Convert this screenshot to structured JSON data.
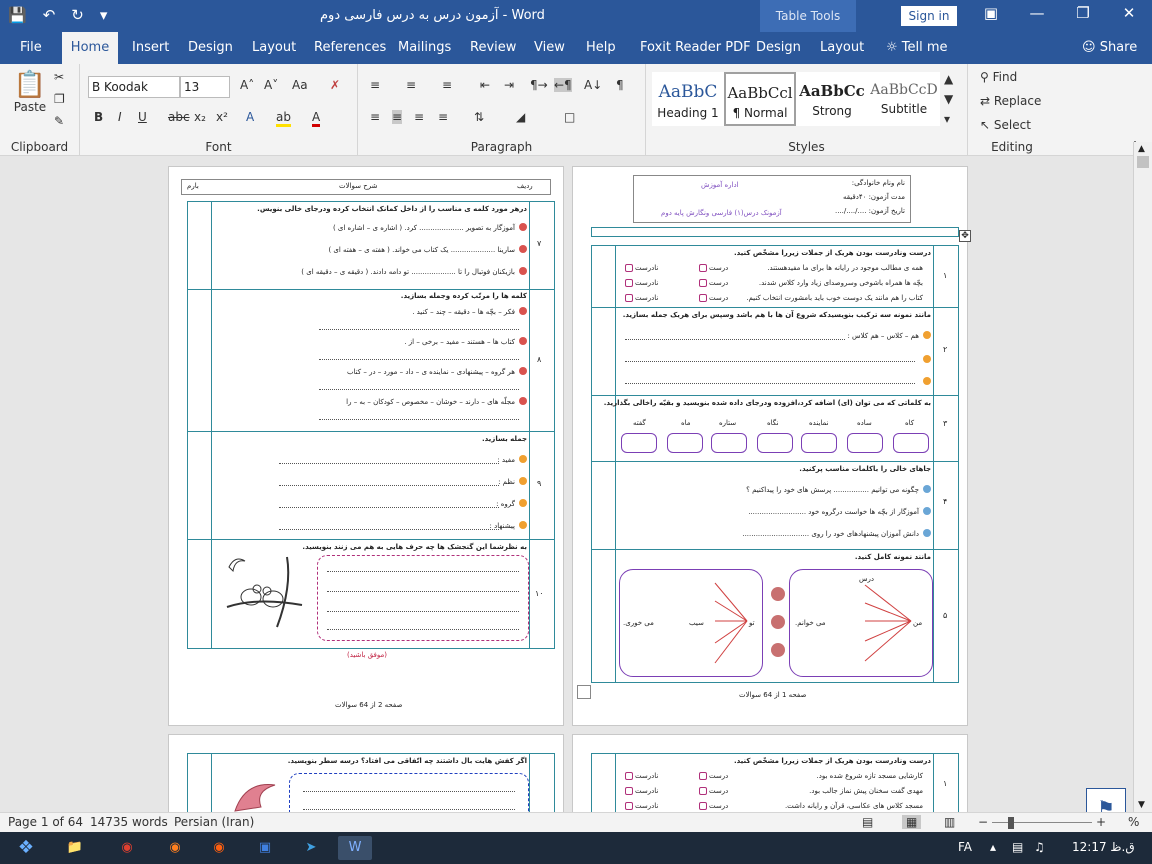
{
  "window": {
    "title": "آزمون درس به درس فارسی دوم  -  Word",
    "table_tools": "Table Tools",
    "sign_in": "Sign in"
  },
  "tabs": [
    "File",
    "Home",
    "Insert",
    "Design",
    "Layout",
    "References",
    "Mailings",
    "Review",
    "View",
    "Help",
    "Foxit Reader PDF",
    "Design",
    "Layout"
  ],
  "tell_me": "Tell me",
  "share": "Share",
  "ribbon": {
    "clipboard": {
      "label": "Clipboard",
      "paste": "Paste"
    },
    "font": {
      "label": "Font",
      "name": "B Koodak",
      "size": "13"
    },
    "paragraph": {
      "label": "Paragraph"
    },
    "styles": {
      "label": "Styles",
      "items": [
        {
          "sample": "AaBbC",
          "name": "Heading 1"
        },
        {
          "sample": "AaBbCcl",
          "name": "¶ Normal"
        },
        {
          "sample": "AaBbCc",
          "name": "Strong"
        },
        {
          "sample": "AaBbCcD",
          "name": "Subtitle"
        }
      ]
    },
    "editing": {
      "label": "Editing",
      "find": "Find",
      "replace": "Replace",
      "select": "Select"
    }
  },
  "doc": {
    "page1": {
      "school": "اداره آموزش",
      "subject": "آزمونک درس(۱) فارسی ونگارش پایه دوم",
      "name_label": "نام ونام خانوادگی:",
      "time_label": "مدت آزمون: ۴۰دقیقه",
      "date_label": "تاریخ آزمون: ..../..../....",
      "q1": "درست ونادرست بودن هریک از جملات زیررا مشخّص کنید.",
      "q1_rows": [
        "همه ی مطالب موجود در رایانه ها برای ما مفیدهستند.",
        "بچّه ها همراه باشوخی وسروصدای زیاد وارد کلاس شدند.",
        "کتاب را هم مانند یک دوست خوب باید بامشورت انتخاب کنیم."
      ],
      "correct": "درست",
      "wrong": "نادرست",
      "q2": "مانند نمونه سه ترکیب بنویسیدکه شروع آن ها با هم باشد وسپس برای هریک جمله بسازید.",
      "q2_example": "هم – کلاس – هم کلاس :",
      "q3": "به کلماتی که می توان (ای) اضافه کرد،افزوده ودرجای داده شده بنویسید و بقیّه راخالی بگذارید.",
      "q3_words": [
        "کاه",
        "ساده",
        "نماینده",
        "نگاه",
        "ستاره",
        "ماه",
        "گفته"
      ],
      "q4": "جاهای خالی را باکلمات مناسب پرکنید.",
      "q4_rows": [
        "چگونه می توانیم ................ پرسش های خود را پیداکنیم ؟",
        "آموزگار از بچّه ها خواست درگروه خود ..........................",
        "دانش آموزان پیشنهادهای خود را روی .............................."
      ],
      "q5": "مانند نمونه کامل کنید.",
      "q5_words": [
        "من",
        "درس",
        "می خوانم.",
        "تو",
        "سیب",
        "می خوری."
      ],
      "footer": "صفحه 1 از 64 سوالات"
    },
    "page2": {
      "header": [
        "ردیف",
        "شرح سوالات",
        "بارم"
      ],
      "q7": "درهر مورد کلمه ی مناسب را از داخل کمانک انتخاب کرده ودرجای خالی بنویس.",
      "q7_rows": [
        "آموزگار به تصویر .................... کرد. ( اشاره ی – اشاره ای )",
        "سارینا .................... یک کتاب می خواند. ( هفته ی – هفته ای )",
        "بازیکنان فوتبال را تا .................... تو دامه دادند. ( دقیقه ی – دقیقه ای )"
      ],
      "q8": "کلمه ها را مرتّب کرده وجمله بسازید.",
      "q8_rows": [
        "فکر – بچّه ها – دقیقه – چند – کنید .",
        "کتاب ها – هستند – مفید – برخی – از .",
        "هر گروه – پیشنهادی – نماینده ی – داد – مورد – در – کتاب",
        "مجلّه های – دارند – خوشان – مخصوص – کودکان – به – را"
      ],
      "q9": "جمله بسازید.",
      "q9_rows": [
        "مفید :",
        "نظم :",
        "گروه :",
        "پیشنهاد :"
      ],
      "q10": "به نظرشما این گنجشک ها چه حرف هایی به هم می زنند بنویسید.",
      "q10_footer": "(موفق باشید)",
      "footer": "صفحه 2 از 64 سوالات"
    },
    "page3": {
      "q6": "اگر کفش هایت بال داشتند چه اتّفاقی می افتاد؟ درسه سطر بنویسید.",
      "q1": "درست ونادرست بودن هریک از جملات زیررا مشخّص کنید.",
      "q1_rows": [
        "کارشایی مسجد تازه شروع شده بود.",
        "مهدی گفت سخنان پیش نماز جالب بود.",
        "مسجد کلاس های عکاسی، قرآن و رایانه داشت."
      ]
    },
    "row_numbers_left": [
      "۷",
      "۸",
      "۹",
      "۱۰"
    ],
    "row_numbers_right": [
      "۱",
      "۲",
      "۳",
      "۴",
      "۵"
    ]
  },
  "status": {
    "page": "Page 1 of 64",
    "words": "14735 words",
    "language": "Persian (Iran)",
    "zoom": "%"
  },
  "taskbar": {
    "lang": "FA",
    "time": "12:17 ق.ظ"
  }
}
